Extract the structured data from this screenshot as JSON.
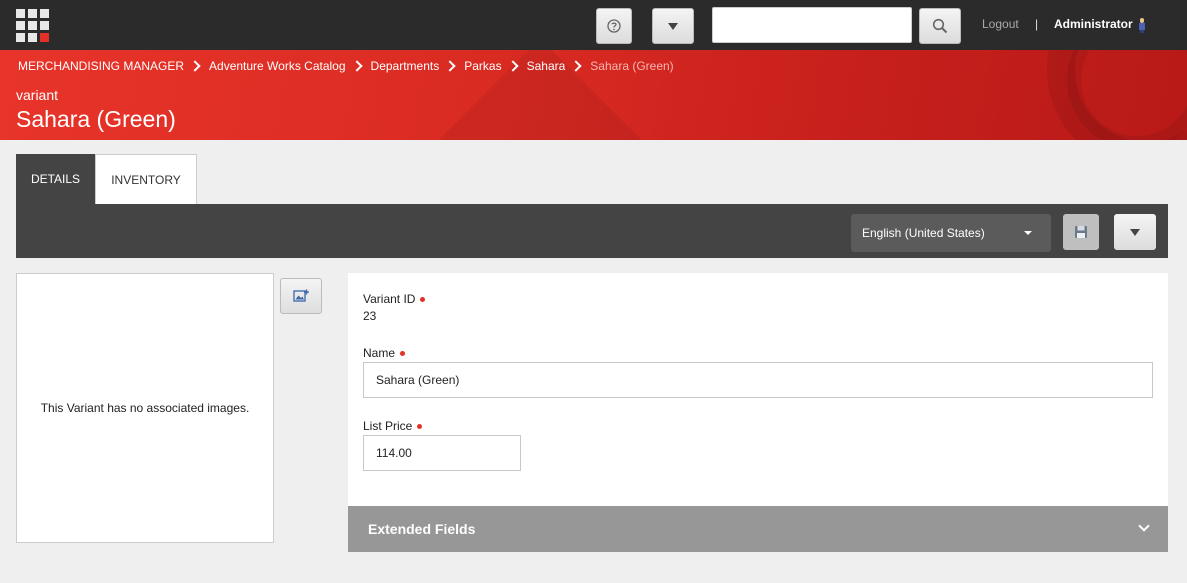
{
  "topbar": {
    "search_placeholder": "",
    "logout_label": "Logout",
    "separator": "|",
    "username": "Administrator"
  },
  "breadcrumb": [
    "MERCHANDISING MANAGER",
    "Adventure Works Catalog",
    "Departments",
    "Parkas",
    "Sahara",
    "Sahara (Green)"
  ],
  "header": {
    "item_type": "variant",
    "title": "Sahara (Green)"
  },
  "tabs": [
    {
      "label": "DETAILS",
      "active": true
    },
    {
      "label": "INVENTORY",
      "active": false
    }
  ],
  "toolbar": {
    "language": "English (United States)"
  },
  "images": {
    "empty_message": "This Variant has no associated images."
  },
  "form": {
    "variant_id": {
      "label": "Variant ID",
      "value": "23"
    },
    "name": {
      "label": "Name",
      "value": "Sahara (Green)"
    },
    "list_price": {
      "label": "List Price",
      "value": "114.00"
    }
  },
  "extended_fields": {
    "label": "Extended Fields"
  },
  "colors": {
    "brand_red": "#e3312a",
    "topbar": "#2b2b2b",
    "toolbar": "#444444",
    "section_header": "#979797"
  }
}
